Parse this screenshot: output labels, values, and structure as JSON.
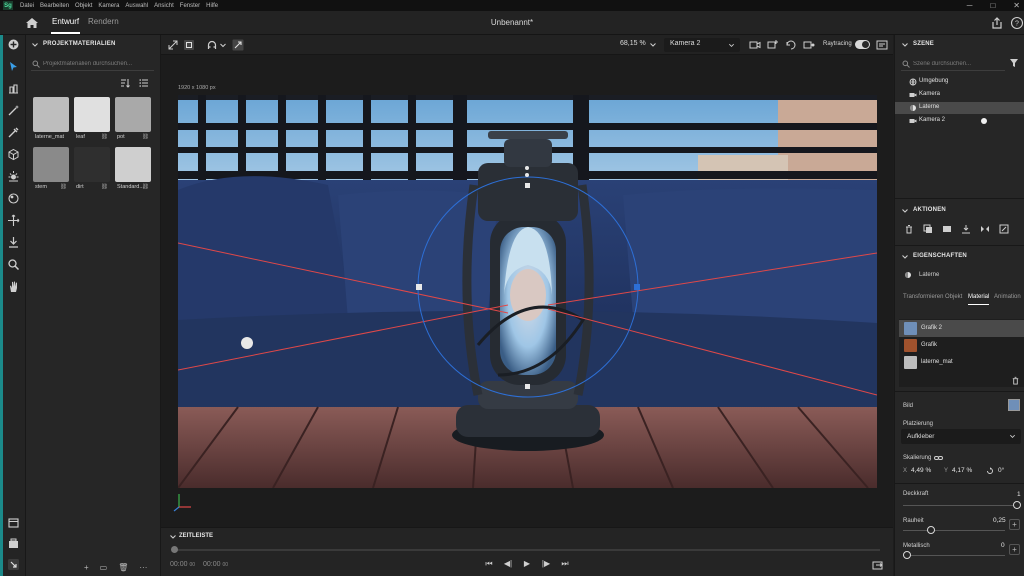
{
  "menu": {
    "app_icon": "Sg",
    "items": [
      "Datei",
      "Bearbeiten",
      "Objekt",
      "Kamera",
      "Auswahl",
      "Ansicht",
      "Fenster",
      "Hilfe"
    ]
  },
  "header": {
    "tabs": [
      {
        "label": "Entwurf",
        "active": true
      },
      {
        "label": "Rendern",
        "active": false
      }
    ],
    "title": "Unbenannt*"
  },
  "left_panel": {
    "title": "PROJEKTMATERIALIEN",
    "search_placeholder": "Projektmaterialien durchsuchen...",
    "materials": [
      {
        "name": "laterne_mat",
        "color": "#bdbdbd",
        "linked": false
      },
      {
        "name": "leaf",
        "color": "#e0e0e0",
        "linked": true
      },
      {
        "name": "pot",
        "color": "#a9a9a9",
        "linked": true
      },
      {
        "name": "stem",
        "color": "#8a8a8a",
        "linked": true
      },
      {
        "name": "dirt",
        "color": "#2f2f2f",
        "linked": true
      },
      {
        "name": "Standard...",
        "color": "#cfcfcf",
        "linked": true
      }
    ],
    "linked_glyph": "⛓"
  },
  "canvas_toolbar": {
    "zoom": "68,15 %",
    "camera": "Kamera 2",
    "raytracing_label": "Raytracing",
    "raytracing_on": true
  },
  "viewport": {
    "resolution": "1920 x 1080 px"
  },
  "timeline": {
    "title": "ZEITLEISTE",
    "time_current": "00:00",
    "time_current_frames": "00",
    "time_total": "00:00",
    "time_total_frames": "00"
  },
  "scene_panel": {
    "title": "SZENE",
    "search_placeholder": "Szene durchsuchen...",
    "items": [
      {
        "label": "Umgebung",
        "icon": "globe-icon",
        "selected": false
      },
      {
        "label": "Kamera",
        "icon": "camera-icon",
        "selected": false
      },
      {
        "label": "Laterne",
        "icon": "sphere-icon",
        "selected": true
      },
      {
        "label": "Kamera 2",
        "icon": "camera-icon",
        "selected": false
      }
    ]
  },
  "actions": {
    "title": "AKTIONEN"
  },
  "properties": {
    "title": "EIGENSCHAFTEN",
    "object_name": "Laterne",
    "tabs": [
      {
        "label": "Transformieren",
        "active": false
      },
      {
        "label": "Objekt",
        "active": false
      },
      {
        "label": "Material",
        "active": true
      },
      {
        "label": "Animation",
        "active": false
      }
    ],
    "material_layers": [
      {
        "label": "Grafik 2",
        "color": "#6f8fb8",
        "selected": true
      },
      {
        "label": "Grafik",
        "color": "#a0522d",
        "selected": false
      },
      {
        "label": "laterne_mat",
        "color": "#bdbdbd",
        "selected": false
      }
    ],
    "image_label": "Bild",
    "placement_label": "Platzierung",
    "placement_value": "Aufkleber",
    "scale_label": "Skalierung",
    "scale_x_label": "X",
    "scale_x": "4,49 %",
    "scale_y_label": "Y",
    "scale_y": "4,17 %",
    "rotation": "0°",
    "opacity_label": "Deckkraft",
    "opacity": "1",
    "roughness_label": "Rauheit",
    "roughness": "0,25",
    "metallic_label": "Metallisch",
    "metallic": "0"
  }
}
